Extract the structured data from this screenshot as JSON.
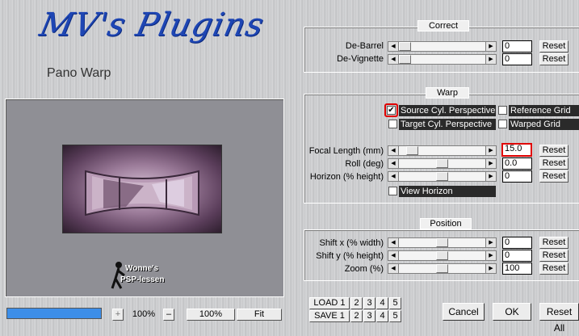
{
  "header": {
    "logo_text": "MV's Plugins",
    "subtitle": "Pano Warp"
  },
  "correct": {
    "title": "Correct",
    "rows": [
      {
        "label": "De-Barrel",
        "value": "0",
        "reset": "Reset"
      },
      {
        "label": "De-Vignette",
        "value": "0",
        "reset": "Reset"
      }
    ]
  },
  "warp": {
    "title": "Warp",
    "source_cyl": "Source Cyl. Perspective",
    "reference_grid": "Reference Grid",
    "target_cyl": "Target Cyl. Perspective",
    "warped_grid": "Warped Grid",
    "rows": [
      {
        "label": "Focal Length (mm)",
        "value": "15.0",
        "reset": "Reset"
      },
      {
        "label": "Roll (deg)",
        "value": "0.0",
        "reset": "Reset"
      },
      {
        "label": "Horizon (% height)",
        "value": "0",
        "reset": "Reset"
      }
    ],
    "view_horizon": "View Horizon"
  },
  "position": {
    "title": "Position",
    "rows": [
      {
        "label": "Shift x (% width)",
        "value": "0",
        "reset": "Reset"
      },
      {
        "label": "Shift y (% height)",
        "value": "0",
        "reset": "Reset"
      },
      {
        "label": "Zoom (%)",
        "value": "100",
        "reset": "Reset"
      }
    ]
  },
  "preview": {
    "watermark_line1": "Wonne's",
    "watermark_line2": "PSP-lessen"
  },
  "zoom": {
    "plus": "+",
    "value": "100%",
    "minus": "–",
    "fit100": "100%",
    "fit": "Fit"
  },
  "presets": {
    "load": "LOAD 1",
    "save": "SAVE 1",
    "slots": [
      "2",
      "3",
      "4",
      "5"
    ]
  },
  "actions": {
    "cancel": "Cancel",
    "ok": "OK",
    "reset_all": "Reset All"
  },
  "colors": {
    "highlight": "#e00000",
    "progress": "#3d8ee8"
  }
}
